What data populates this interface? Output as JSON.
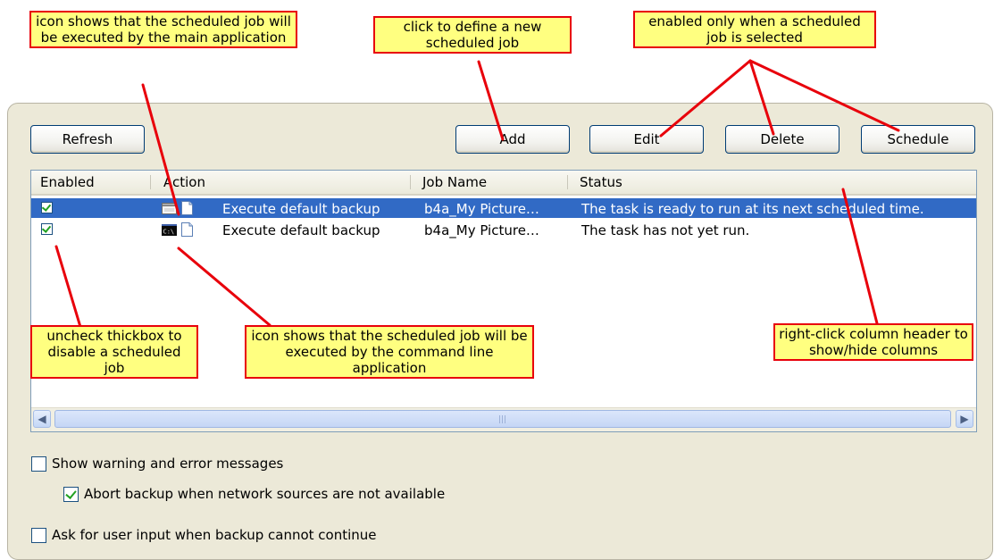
{
  "toolbar": {
    "refresh_label": "Refresh",
    "add_label": "Add",
    "edit_label": "Edit",
    "delete_label": "Delete",
    "schedule_label": "Schedule"
  },
  "table": {
    "columns": [
      "Enabled",
      "Action",
      "Job Name",
      "Status"
    ],
    "rows": [
      {
        "enabled": true,
        "executor_icon": "main-application-icon",
        "action": "Execute default backup",
        "job_name": "b4a_My Picture…",
        "status": "The task is ready to run at its next scheduled time.",
        "selected": true
      },
      {
        "enabled": true,
        "executor_icon": "command-line-icon",
        "action": "Execute default backup",
        "job_name": "b4a_My Picture…",
        "status": "The task has not yet run.",
        "selected": false
      }
    ]
  },
  "options": {
    "show_warnings": {
      "label": "Show warning and error messages",
      "checked": false
    },
    "abort_backup": {
      "label": "Abort backup when network sources are not available",
      "checked": true
    },
    "ask_input": {
      "label": "Ask for user input when backup cannot continue",
      "checked": false
    }
  },
  "callouts": {
    "main_app": "icon shows that the scheduled job will be executed by the main application",
    "add": "click to define a new scheduled job",
    "enabled_only": "enabled only when a scheduled job is selected",
    "uncheck": "uncheck thickbox to disable a scheduled job",
    "command_line": "icon shows that the scheduled job will be executed by the command line application",
    "right_click": "right-click column header to show/hide columns"
  },
  "colors": {
    "selection": "#316ac5",
    "callout_fill": "#ffff80",
    "callout_border": "#e8000b",
    "panel": "#ece9d8"
  }
}
